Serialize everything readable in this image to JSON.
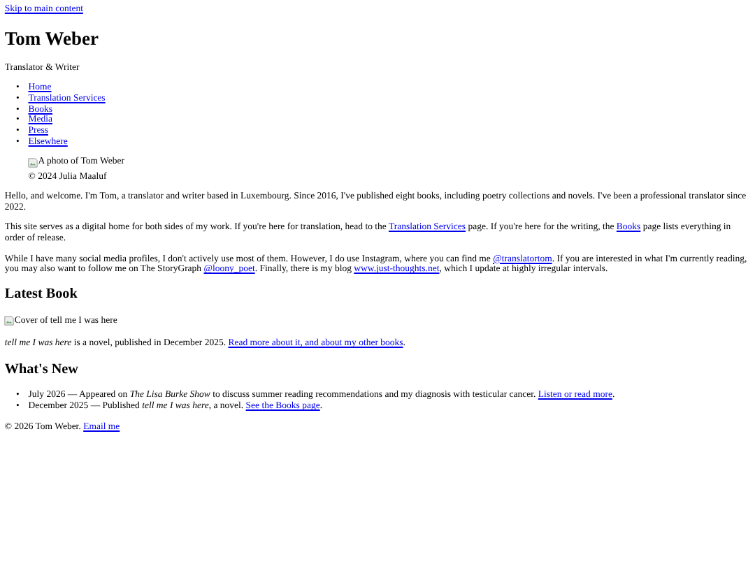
{
  "skip_link": "Skip to main content",
  "site_title": "Tom Weber",
  "tagline": "Translator & Writer",
  "nav": [
    {
      "marker": "•",
      "label": "Home"
    },
    {
      "marker": "•",
      "label": "Translation Services"
    },
    {
      "marker": "•",
      "label": "Books"
    },
    {
      "marker": "•",
      "label": "Media"
    },
    {
      "marker": "•",
      "label": "Press"
    },
    {
      "marker": "•",
      "label": "Elsewhere"
    }
  ],
  "photo": {
    "alt": "A photo of Tom Weber",
    "caption": "© 2024 Julia Maaluf"
  },
  "intro": [
    [
      {
        "kind": "text",
        "text": "Hello, and welcome. I'm Tom, a translator and writer based in Luxembourg. Since 2016, I've published eight books, including poetry collections and novels. I've been a professional translator since 2022."
      }
    ],
    [
      {
        "kind": "text",
        "text": "This site serves as a digital home for both sides of my work. If you're here for translation, head to the "
      },
      {
        "kind": "link",
        "text": "Translation Services"
      },
      {
        "kind": "text",
        "text": " page. If you're here for the writing, the "
      },
      {
        "kind": "link",
        "text": "Books"
      },
      {
        "kind": "text",
        "text": " page lists everything in order of release."
      }
    ],
    [
      {
        "kind": "text",
        "text": "While I have many social media profiles, I don't actively use most of them. However, I do use Instagram, where you can find me "
      },
      {
        "kind": "link",
        "text": "@translatortom"
      },
      {
        "kind": "text",
        "text": ". If you are interested in what I'm currently reading, you may also want to follow me on The StoryGraph "
      },
      {
        "kind": "link",
        "text": "@loony_poet"
      },
      {
        "kind": "text",
        "text": ". Finally, there is my blog "
      },
      {
        "kind": "link",
        "text": "www.just-thoughts.net"
      },
      {
        "kind": "text",
        "text": ", which I update at highly irregular intervals."
      }
    ]
  ],
  "latest": {
    "heading": "Latest Book",
    "cover_alt": "Cover of tell me I was here",
    "text": [
      {
        "kind": "text",
        "text": "*tell me I was here* is a novel, published in December 2025. "
      },
      {
        "kind": "link",
        "text": "Read more about it, and about my other books"
      },
      {
        "kind": "text",
        "text": "."
      }
    ]
  },
  "news": {
    "heading": "What's New",
    "items": [
      {
        "marker": "•",
        "parts": [
          {
            "kind": "text",
            "text": "July 2026 — Appeared on *The Lisa Burke Show* to discuss summer reading recommendations and my diagnosis with testicular cancer. "
          },
          {
            "kind": "link",
            "text": "Listen or read more"
          },
          {
            "kind": "text",
            "text": "."
          }
        ]
      },
      {
        "marker": "•",
        "parts": [
          {
            "kind": "text",
            "text": "December 2025 — Published *tell me I was here*, a novel. "
          },
          {
            "kind": "link",
            "text": "See the Books page"
          },
          {
            "kind": "text",
            "text": "."
          }
        ]
      }
    ]
  },
  "footer": [
    {
      "kind": "text",
      "text": "© 2026 Tom Weber. "
    },
    {
      "kind": "link",
      "text": "Email me"
    }
  ]
}
